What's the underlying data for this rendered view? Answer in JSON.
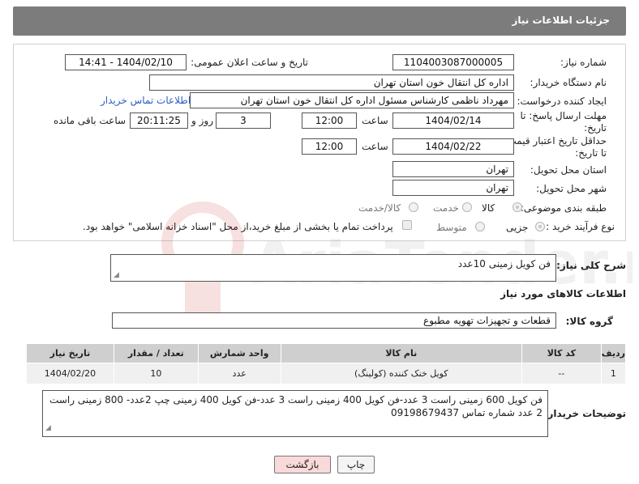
{
  "header": {
    "title": "جزئیات اطلاعات نیاز"
  },
  "form": {
    "need_number_label": "شماره نیاز:",
    "need_number": "1104003087000005",
    "announce_label": "تاریخ و ساعت اعلان عمومی:",
    "announce_value": "1404/02/10 - 14:41",
    "buyer_org_label": "نام دستگاه خریدار:",
    "buyer_org": "اداره کل انتقال خون استان تهران",
    "creator_label": "ایجاد کننده درخواست:",
    "creator": "مهرداد ناظمی کارشناس مسئول اداره کل انتقال خون استان تهران",
    "contact_link": "اطلاعات تماس خریدار",
    "deadline_label_1": "مهلت ارسال پاسخ: تا",
    "deadline_label_2": "تاریخ:",
    "deadline_date": "1404/02/14",
    "time_label": "ساعت",
    "deadline_time": "12:00",
    "days_value": "3",
    "days_label": "روز و",
    "remaining_value": "20:11:25",
    "remaining_label": "ساعت باقی مانده",
    "validity_label_1": "حداقل تاریخ اعتبار قیمت:",
    "validity_label_2": "تا تاریخ:",
    "validity_date": "1404/02/22",
    "validity_time": "12:00",
    "province_label": "استان محل تحویل:",
    "province": "تهران",
    "city_label": "شهر محل تحویل:",
    "city": "تهران",
    "category_label": "طبقه بندی موضوعی:",
    "category_options": [
      "کالا",
      "خدمت",
      "کالا/خدمت"
    ],
    "process_label": "نوع فرآیند خرید :",
    "process_options": [
      "جزیی",
      "متوسط"
    ],
    "payment_note": "پرداخت تمام یا بخشی از مبلغ خرید،از محل \"اسناد خزانه اسلامی\" خواهد بود."
  },
  "description": {
    "label": "شرح کلی نیاز:",
    "value": "فن کویل زمینی 10عدد"
  },
  "goods": {
    "section_title": "اطلاعات کالاهای مورد نیاز",
    "group_label": "گروه کالا:",
    "group_value": "قطعات و تجهیزات تهویه مطبوع",
    "columns": [
      "ردیف",
      "کد کالا",
      "نام کالا",
      "واحد شمارش",
      "تعداد / مقدار",
      "تاریخ نیاز"
    ],
    "rows": [
      {
        "row": "1",
        "code": "--",
        "name": "کویل خنک کننده (کولینگ)",
        "unit": "عدد",
        "qty": "10",
        "date": "1404/02/20"
      }
    ]
  },
  "buyer_notes": {
    "label": "توضیحات خریدار:",
    "value": "فن کویل 600 زمینی راست 3 عدد-فن کویل 400 زمینی راست 3 عدد-فن کویل 400 زمینی چپ 2عدد- 800 زمینی راست 2 عدد شماره تماس 09198679437"
  },
  "buttons": {
    "print": "چاپ",
    "back": "بازگشت"
  },
  "watermark": "AriaTender.neT",
  "colors": {
    "header_bg": "#7c7c7c",
    "link": "#2c5ec2",
    "back_btn_bg": "#f9d9d9",
    "watermark": "#c01818"
  }
}
